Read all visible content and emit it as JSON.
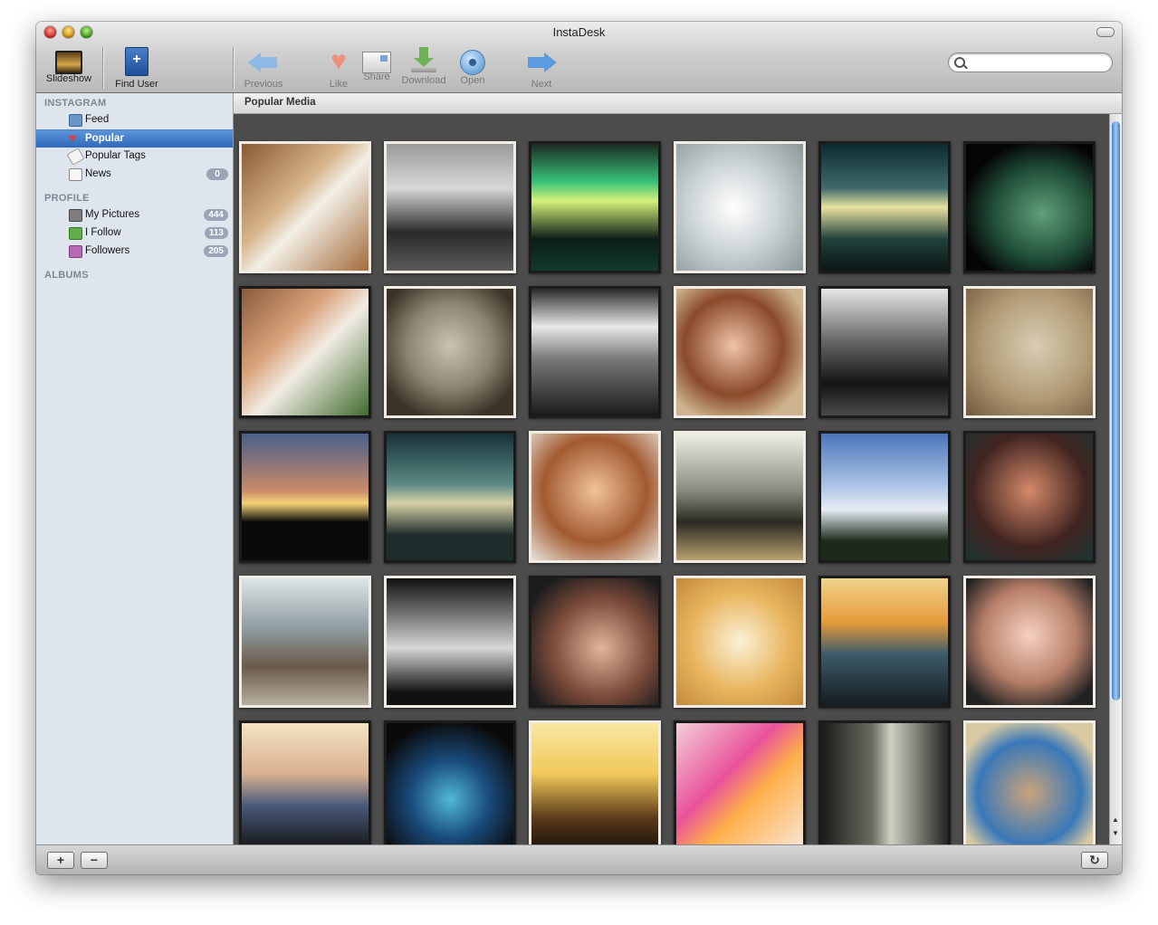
{
  "window": {
    "title": "InstaDesk"
  },
  "toolbar": {
    "slideshow": "Slideshow",
    "find_user": "Find User",
    "previous": "Previous",
    "like": "Like",
    "share": "Share",
    "download": "Download",
    "open": "Open",
    "next": "Next"
  },
  "search": {
    "placeholder": "",
    "value": ""
  },
  "sidebar": {
    "instagram_header": "INSTAGRAM",
    "profile_header": "PROFILE",
    "albums_header": "ALBUMS",
    "instagram_items": [
      {
        "label": "Feed",
        "icon": "feed-icon"
      },
      {
        "label": "Popular",
        "icon": "heart-icon",
        "selected": true
      },
      {
        "label": "Popular Tags",
        "icon": "tag-icon"
      },
      {
        "label": "News",
        "icon": "news-icon",
        "badge": "0"
      }
    ],
    "profile_items": [
      {
        "label": "My Pictures",
        "icon": "camera-icon",
        "badge": "444"
      },
      {
        "label": "I Follow",
        "icon": "follow-icon",
        "badge": "113"
      },
      {
        "label": "Followers",
        "icon": "followers-icon",
        "badge": "205"
      }
    ]
  },
  "main": {
    "header": "Popular Media"
  },
  "photos": [
    {
      "bg": "linear-gradient(135deg,#8a5a32,#d7b48a 40%,#f2efe6 55%,#a36b3a)",
      "framed": true
    },
    {
      "bg": "linear-gradient(#9a9a9a,#d8d8d8 35%,#2a2a2a 70%,#5b5b5b)",
      "framed": true
    },
    {
      "bg": "linear-gradient(#1a2a22,#39c27a 30%,#d5f17a 45%,#0b1d16 75%,#133a2a)",
      "framed": false
    },
    {
      "bg": "radial-gradient(circle at 45% 50%,#ffffff,#cfd6d8 45%,#8a9798)",
      "framed": true
    },
    {
      "bg": "linear-gradient(#0c2b30,#3f6a6a 35%,#e8e2a0 50%,#21423c 75%,#0b1715)",
      "framed": false
    },
    {
      "bg": "radial-gradient(ellipse at 60% 55%,#5f9f78,#21503a 45%,#050505 75%)",
      "framed": false
    },
    {
      "bg": "linear-gradient(135deg,#8a5b3a,#d9a27a 35%,#f1ece4 55%,#3f6b2e)",
      "framed": false
    },
    {
      "bg": "radial-gradient(circle at 50% 45%,#c9c3b0,#8c8573 45%,#3a3326 80%)",
      "framed": true
    },
    {
      "bg": "linear-gradient(#2a2a2a,#e8e8e8 30%,#7a7a7a 55%,#1a1a1a)",
      "framed": false
    },
    {
      "bg": "radial-gradient(circle at 45% 45%,#f0c3a8,#8a4a2a 50%,#ceb48e 80%)",
      "framed": true
    },
    {
      "bg": "linear-gradient(#e7e7e7,#6a6a6a 40%,#141414 75%,#4a4a4a)",
      "framed": false
    },
    {
      "bg": "radial-gradient(circle at 55% 45%,#d9cdb3,#b09a75 55%,#6f5a3b)",
      "framed": true
    },
    {
      "bg": "linear-gradient(#4a5f8a,#c98a6a 45%,#f6d37a 55%,#0a0a0a 70%)",
      "framed": false
    },
    {
      "bg": "linear-gradient(#173036,#5b8a86 40%,#d7d2a6 55%,#1e2c2c 80%)",
      "framed": false
    },
    {
      "bg": "radial-gradient(circle at 50% 45%,#f1c39a,#a25a30 55%,#e9e3da)",
      "framed": true
    },
    {
      "bg": "linear-gradient(#efefe6,#8a8a80 45%,#2a2a24 70%,#b8a070)",
      "framed": true
    },
    {
      "bg": "linear-gradient(#4b75b9,#a9c1e4 40%,#e7ecf3 60%,#1b2a1a 85%)",
      "framed": false
    },
    {
      "bg": "radial-gradient(circle at 50% 45%,#d58a6a,#402420 60%,#1b3334)",
      "framed": false
    },
    {
      "bg": "linear-gradient(#dce6e8,#8e9b9e 40%,#6a5a4a 70%,#b7b0a2)",
      "framed": true
    },
    {
      "bg": "linear-gradient(#111,#7a7a7a 30%,#d8d8d8 55%,#111 90%)",
      "framed": true
    },
    {
      "bg": "radial-gradient(circle at 55% 55%,#e3b39a,#7a4a3a 50%,#1c1c1c 85%)",
      "framed": false
    },
    {
      "bg": "radial-gradient(circle at 50% 50%,#fbf1d7,#e8b55e 55%,#c28a3a)",
      "framed": true
    },
    {
      "bg": "linear-gradient(#f1d38a,#e49a3a 35%,#3d5a6a 60%,#151d20)",
      "framed": false
    },
    {
      "bg": "radial-gradient(circle at 50% 45%,#f6d1c0,#b8806a 50%,#222 85%)",
      "framed": true
    },
    {
      "bg": "linear-gradient(#f4e3c2,#d8b190 40%,#4a5a7a 65%,#141414)",
      "framed": false
    },
    {
      "bg": "radial-gradient(circle at 50% 60%,#51b9d6,#194a7a 40%,#0a0a0a 80%)",
      "framed": false
    },
    {
      "bg": "linear-gradient(#f8e7a2,#f1c85a 40%,#5a3a1a 75%,#1a120a)",
      "framed": true
    },
    {
      "bg": "linear-gradient(135deg,#f3cfd8,#e9529a 40%,#ffb04a 60%,#f9e6d7)",
      "framed": false
    },
    {
      "bg": "linear-gradient(90deg,#1a1a1a,#6a6a60 40%,#cfcfc2 55%,#222)",
      "framed": false
    },
    {
      "bg": "radial-gradient(circle at 50% 55%,#c9a47a,#3a78b8 55%,#d8c9a2 80%)",
      "framed": true
    }
  ]
}
